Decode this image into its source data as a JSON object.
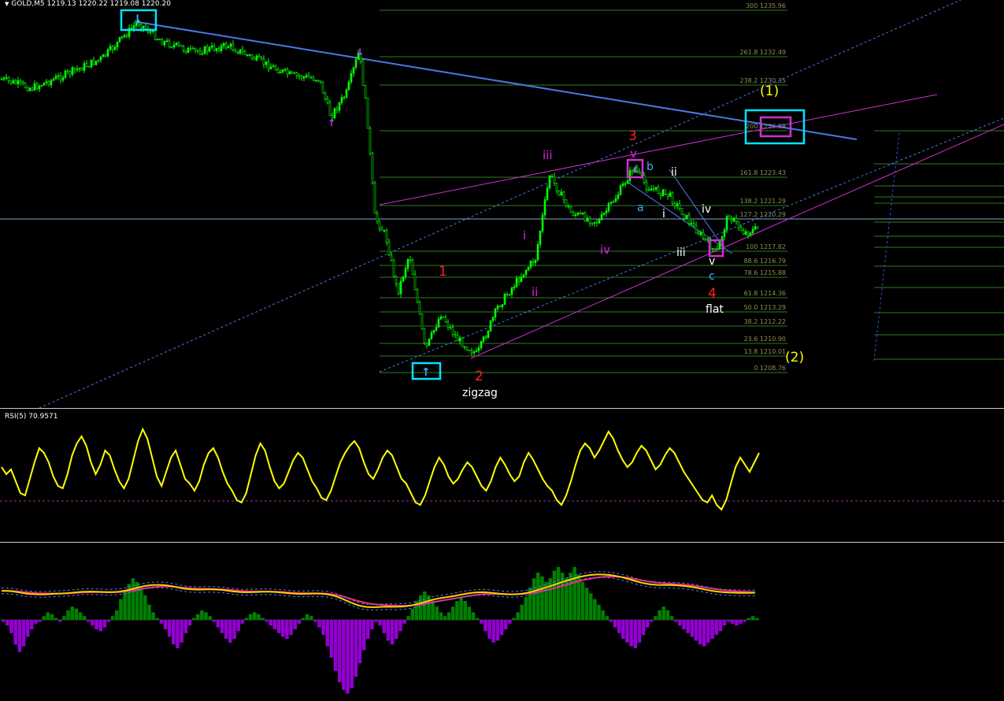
{
  "header": {
    "symbol": "GOLD,M5",
    "ohlc": "1219.13 1220.22 1219.08 1220.20",
    "menu_glyph": "▼"
  },
  "rsi": {
    "label": "RSI(5) 70.9571"
  },
  "colors": {
    "background": "#000000",
    "bull_candle": "#00ff00",
    "fib_lines": "#2f7a1f",
    "fib_text": "#8f8f4f",
    "trendline_blue": "#4a78e8",
    "channel_magenta": "#d030d0",
    "rsi_line": "#ffff00",
    "macd_pos": "#008000",
    "macd_neg": "#9400d3",
    "wave_red": "#ff2020",
    "wave_magenta": "#e020e0",
    "wave_cyan": "#3ab0ff",
    "wave_yellow": "#ffff00"
  },
  "chart_data": [
    {
      "type": "candlestick",
      "title": "GOLD,M5",
      "fib_levels": [
        {
          "ratio": "300",
          "price": "1235.96"
        },
        {
          "ratio": "261.8",
          "price": "1232.49"
        },
        {
          "ratio": "238.2",
          "price": "1230.35"
        },
        {
          "ratio": "200",
          "price": "1226.89"
        },
        {
          "ratio": "161.8",
          "price": "1223.43"
        },
        {
          "ratio": "138.2",
          "price": "1221.29"
        },
        {
          "ratio": "127.2",
          "price": "1220.29"
        },
        {
          "ratio": "100",
          "price": "1217.82"
        },
        {
          "ratio": "88.6",
          "price": "1216.79"
        },
        {
          "ratio": "78.6",
          "price": "1215.88"
        },
        {
          "ratio": "61.8",
          "price": "1214.36"
        },
        {
          "ratio": "50.0",
          "price": "1213.29"
        },
        {
          "ratio": "38.2",
          "price": "1212.22"
        },
        {
          "ratio": "23.6",
          "price": "1210.90"
        },
        {
          "ratio": "13.8",
          "price": "1210.01"
        },
        {
          "ratio": "0",
          "price": "1208.76"
        }
      ],
      "wave_labels": [
        {
          "text": "(1)",
          "color": "yellow"
        },
        {
          "text": "(2)",
          "color": "yellow"
        },
        {
          "text": "1",
          "color": "red"
        },
        {
          "text": "2",
          "color": "red"
        },
        {
          "text": "3",
          "color": "red"
        },
        {
          "text": "4",
          "color": "red"
        },
        {
          "text": "zigzag",
          "color": "white"
        },
        {
          "text": "flat",
          "color": "white"
        },
        {
          "text": "i",
          "color": "magenta"
        },
        {
          "text": "ii",
          "color": "magenta"
        },
        {
          "text": "iii",
          "color": "magenta"
        },
        {
          "text": "iv",
          "color": "magenta"
        },
        {
          "text": "v",
          "color": "magenta"
        },
        {
          "text": "a",
          "color": "cyan"
        },
        {
          "text": "b",
          "color": "cyan"
        },
        {
          "text": "c",
          "color": "cyan"
        },
        {
          "text": "i",
          "color": "white"
        },
        {
          "text": "ii",
          "color": "white"
        },
        {
          "text": "iii",
          "color": "white"
        },
        {
          "text": "iv",
          "color": "white"
        },
        {
          "text": "v",
          "color": "white"
        }
      ]
    },
    {
      "type": "line",
      "title": "RSI(5) 70.9571",
      "level": 50,
      "ylim": [
        0,
        100
      ],
      "values": [
        58,
        52,
        56,
        46,
        36,
        34,
        48,
        62,
        74,
        70,
        62,
        50,
        42,
        40,
        52,
        68,
        78,
        84,
        76,
        62,
        52,
        60,
        72,
        68,
        56,
        46,
        40,
        48,
        64,
        80,
        90,
        82,
        66,
        50,
        42,
        54,
        66,
        72,
        60,
        48,
        44,
        38,
        46,
        60,
        70,
        74,
        66,
        54,
        44,
        38,
        30,
        28,
        36,
        52,
        68,
        78,
        72,
        58,
        46,
        40,
        44,
        54,
        64,
        70,
        66,
        56,
        46,
        40,
        32,
        30,
        38,
        50,
        62,
        70,
        76,
        80,
        74,
        62,
        52,
        48,
        56,
        66,
        72,
        68,
        58,
        48,
        44,
        36,
        28,
        26,
        34,
        46,
        58,
        66,
        60,
        50,
        44,
        48,
        56,
        62,
        58,
        50,
        42,
        38,
        46,
        58,
        66,
        60,
        52,
        46,
        50,
        62,
        70,
        64,
        56,
        48,
        42,
        38,
        30,
        26,
        34,
        46,
        60,
        72,
        78,
        74,
        66,
        72,
        80,
        88,
        82,
        72,
        64,
        58,
        62,
        70,
        76,
        72,
        64,
        56,
        60,
        68,
        74,
        70,
        62,
        54,
        48,
        42,
        36,
        30,
        28,
        34,
        26,
        22,
        30,
        44,
        58,
        66,
        60,
        54,
        62,
        70
      ]
    },
    {
      "type": "bar",
      "title": "MACD histogram",
      "series": [
        {
          "values": [
            -2,
            -6,
            -14,
            -26,
            -34,
            -28,
            -18,
            -10,
            -4,
            -2,
            4,
            8,
            6,
            2,
            -2,
            4,
            10,
            14,
            12,
            8,
            4,
            -2,
            -6,
            -10,
            -12,
            -8,
            -2,
            4,
            10,
            22,
            30,
            38,
            44,
            40,
            34,
            26,
            16,
            8,
            2,
            -4,
            -10,
            -18,
            -26,
            -30,
            -24,
            -14,
            -6,
            2,
            6,
            10,
            8,
            4,
            -2,
            -8,
            -14,
            -20,
            -24,
            -20,
            -12,
            -4,
            2,
            6,
            8,
            6,
            2,
            -2,
            -6,
            -10,
            -14,
            -18,
            -20,
            -16,
            -10,
            -4,
            2,
            6,
            4,
            -2,
            -8,
            -16,
            -28,
            -40,
            -54,
            -66,
            -74,
            -78,
            -72,
            -60,
            -46,
            -32,
            -20,
            -10,
            -2,
            -6,
            -14,
            -22,
            -26,
            -20,
            -12,
            -4,
            4,
            12,
            20,
            26,
            30,
            26,
            20,
            14,
            8,
            4,
            8,
            14,
            20,
            24,
            20,
            14,
            8,
            2,
            -4,
            -12,
            -20,
            -24,
            -22,
            -16,
            -10,
            -4,
            2,
            8,
            16,
            24,
            34,
            44,
            50,
            46,
            40,
            44,
            52,
            56,
            50,
            44,
            50,
            56,
            48,
            40,
            34,
            28,
            22,
            16,
            10,
            4,
            -2,
            -8,
            -14,
            -20,
            -24,
            -28,
            -30,
            -24,
            -16,
            -8,
            -2,
            4,
            10,
            14,
            10,
            4,
            -2,
            -6,
            -10,
            -14,
            -18,
            -22,
            -26,
            -28,
            -24,
            -20,
            -16,
            -12,
            -6,
            -2,
            -4,
            -6,
            -4,
            -2,
            2,
            4,
            2
          ]
        }
      ]
    }
  ]
}
